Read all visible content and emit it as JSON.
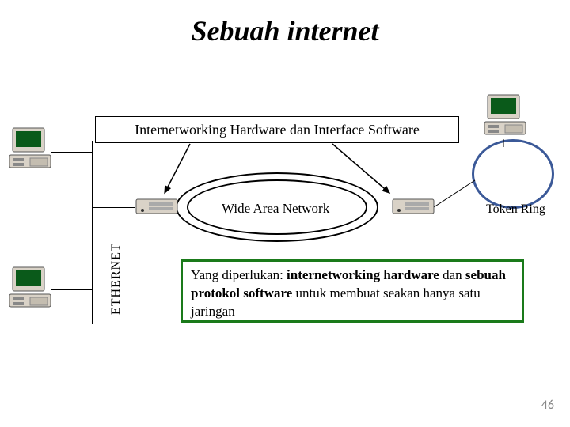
{
  "title": "Sebuah internet",
  "subtitle": "Internetworking Hardware dan Interface Software",
  "labels": {
    "ethernet": "ETHERNET",
    "wan": "Wide Area Network",
    "token_ring": "Token Ring"
  },
  "description": {
    "prefix": "Yang diperlukan: ",
    "bold1": "internetworking hardware",
    "mid": " dan ",
    "bold2": "sebuah protokol software",
    "suffix": " untuk membuat seakan hanya satu jaringan"
  },
  "slide_number": "46",
  "icons": {
    "computer": "computer-icon",
    "router": "router-icon"
  }
}
